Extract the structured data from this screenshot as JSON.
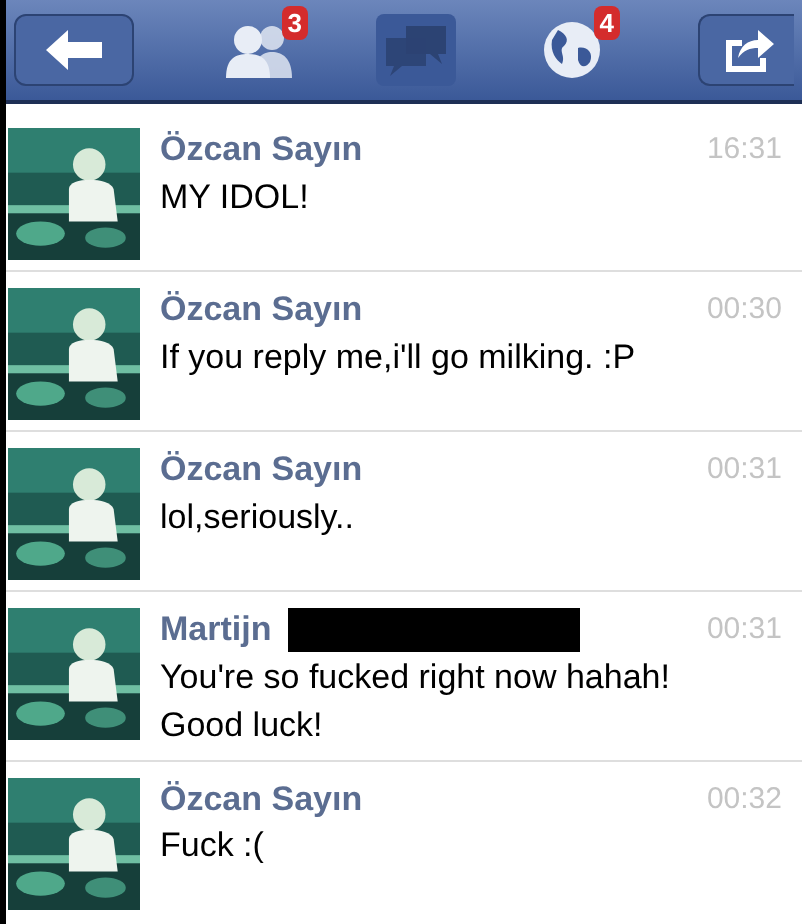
{
  "nav_bar": {
    "tabs": [
      {
        "kind": "friends",
        "badge": "3",
        "selected": false
      },
      {
        "kind": "messages",
        "selected": true
      },
      {
        "kind": "notifications",
        "badge": "4",
        "selected": false
      }
    ]
  },
  "messages": [
    {
      "sender": "Özcan Sayın",
      "time": "16:31",
      "text": "MY IDOL!",
      "redacted": false
    },
    {
      "sender": "Özcan Sayın",
      "time": "00:30",
      "text": "If you reply me,i'll go milking. :P",
      "redacted": false
    },
    {
      "sender": "Özcan Sayın",
      "time": "00:31",
      "text": "lol,seriously..",
      "redacted": false
    },
    {
      "sender": "Martijn",
      "time": "00:31",
      "text": "You're so fucked right now hahah! Good luck!",
      "redacted": true
    },
    {
      "sender": "Özcan Sayın",
      "time": "00:32",
      "text": "Fuck :(",
      "redacted": false
    }
  ]
}
